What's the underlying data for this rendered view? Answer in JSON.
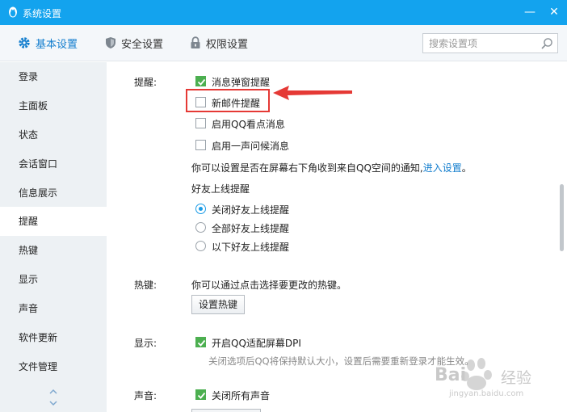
{
  "window": {
    "title": "系统设置",
    "min_glyph": "—",
    "close_glyph": "✕"
  },
  "toolbar": {
    "tabs": [
      {
        "label": "基本设置",
        "icon": "gear-icon",
        "active": true
      },
      {
        "label": "安全设置",
        "icon": "shield-icon",
        "active": false
      },
      {
        "label": "权限设置",
        "icon": "lock-icon",
        "active": false
      }
    ],
    "search_placeholder": "搜索设置项"
  },
  "sidebar": {
    "items": [
      {
        "label": "登录"
      },
      {
        "label": "主面板"
      },
      {
        "label": "状态"
      },
      {
        "label": "会话窗口"
      },
      {
        "label": "信息展示"
      },
      {
        "label": "提醒",
        "active": true
      },
      {
        "label": "热键"
      },
      {
        "label": "显示"
      },
      {
        "label": "声音"
      },
      {
        "label": "软件更新"
      },
      {
        "label": "文件管理"
      }
    ]
  },
  "content": {
    "reminder": {
      "label": "提醒:",
      "options": [
        {
          "label": "消息弹窗提醒",
          "checked": true
        },
        {
          "label": "新邮件提醒",
          "checked": false
        },
        {
          "label": "启用QQ看点消息",
          "checked": false
        },
        {
          "label": "启用一声问候消息",
          "checked": false
        }
      ],
      "notice_text": "你可以设置是否在屏幕右下角收到来自QQ空间的通知,",
      "notice_link": "进入设置",
      "notice_end": "。",
      "friend_online_title": "好友上线提醒",
      "friend_online_options": [
        {
          "label": "关闭好友上线提醒",
          "selected": true
        },
        {
          "label": "全部好友上线提醒",
          "selected": false
        },
        {
          "label": "以下好友上线提醒",
          "selected": false
        }
      ]
    },
    "hotkey": {
      "label": "热键:",
      "description": "你可以通过点击选择要更改的热键。",
      "button": "设置热键"
    },
    "display": {
      "label": "显示:",
      "option": {
        "label": "开启QQ适配屏幕DPI",
        "checked": true
      },
      "hint": "关闭选项后QQ将保持默认大小，设置后需要重新登录才能生效。"
    },
    "sound": {
      "label": "声音:",
      "option": {
        "label": "关闭所有声音",
        "checked": true
      }
    }
  },
  "watermark": {
    "brand": "Bai",
    "brand2": "经验",
    "url": "jingyan.baidu.com"
  },
  "colors": {
    "titlebar": "#13a3ee",
    "accent": "#137ece",
    "check": "#4caf50",
    "annotation": "#e53935"
  }
}
